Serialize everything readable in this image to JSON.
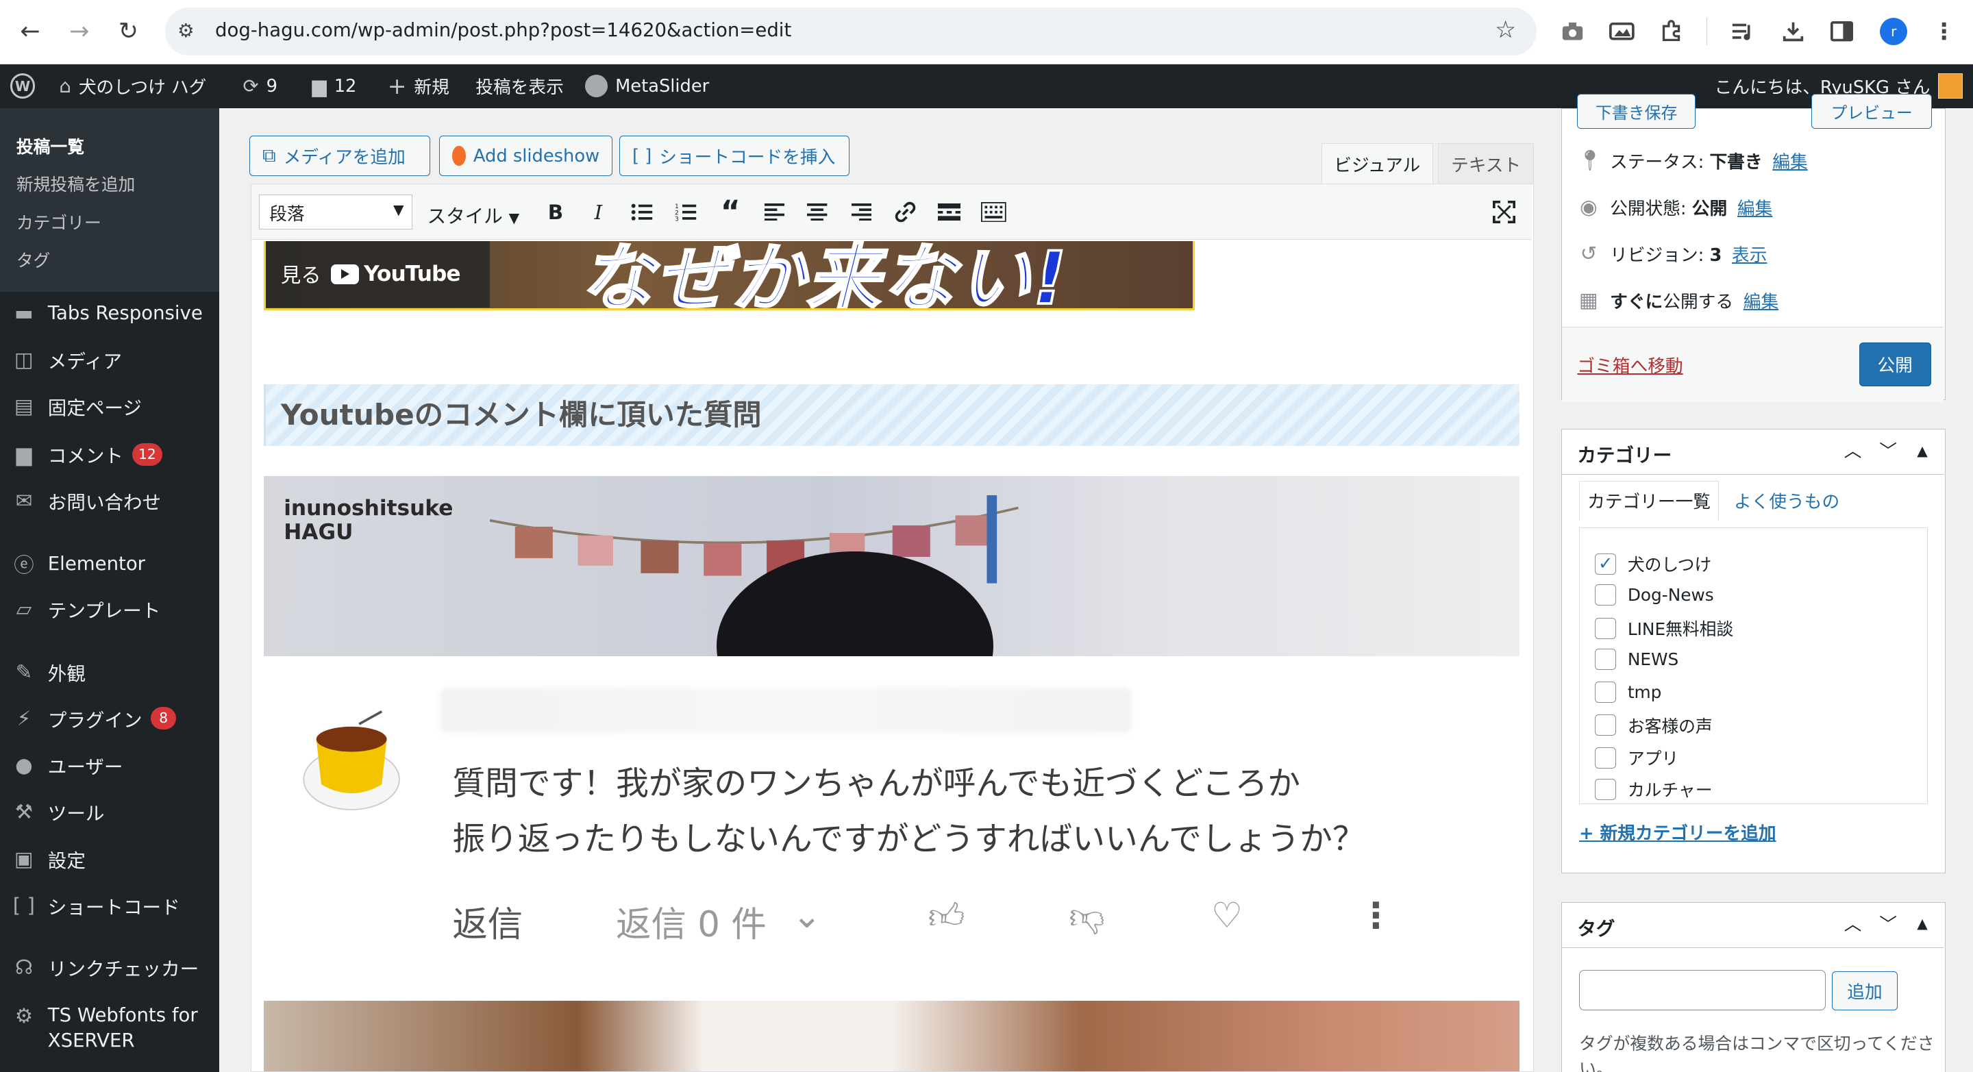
{
  "browser": {
    "url": "dog-hagu.com/wp-admin/post.php?post=14620&action=edit",
    "profile_initial": "r"
  },
  "adminbar": {
    "site_name": "犬のしつけ ハグ",
    "updates_count": "9",
    "comments_count": "12",
    "new_label": "新規",
    "view_post": "投稿を表示",
    "metaslider": "MetaSlider",
    "greeting": "こんにちは、RyuSKG さん"
  },
  "sidebar": {
    "submenu": [
      "投稿一覧",
      "新規投稿を追加",
      "カテゴリー",
      "タグ"
    ],
    "items": [
      {
        "label": "Tabs Responsive",
        "icon": "folder-icon"
      },
      {
        "label": "メディア",
        "icon": "media-icon"
      },
      {
        "label": "固定ページ",
        "icon": "page-icon"
      },
      {
        "label": "コメント",
        "icon": "comment-icon",
        "badge": "12"
      },
      {
        "label": "お問い合わせ",
        "icon": "mail-icon"
      },
      {
        "label": "Elementor",
        "icon": "elementor-icon"
      },
      {
        "label": "テンプレート",
        "icon": "folder-open-icon"
      },
      {
        "label": "外観",
        "icon": "brush-icon"
      },
      {
        "label": "プラグイン",
        "icon": "plugin-icon",
        "badge": "8"
      },
      {
        "label": "ユーザー",
        "icon": "user-icon"
      },
      {
        "label": "ツール",
        "icon": "wrench-icon"
      },
      {
        "label": "設定",
        "icon": "settings-icon"
      },
      {
        "label": "ショートコード",
        "icon": "shortcode-icon"
      },
      {
        "label": "リンクチェッカー",
        "icon": "link-checker-icon"
      },
      {
        "label": "TS Webfonts for XSERVER",
        "icon": "gear-icon"
      }
    ]
  },
  "editor": {
    "add_media": "メディアを追加",
    "add_slideshow": "Add slideshow",
    "insert_shortcode": "ショートコードを挿入",
    "tab_visual": "ビジュアル",
    "tab_text": "テキスト",
    "format_select": "段落",
    "style_select": "スタイル",
    "yt_watch": "見る",
    "yt_logo": "YouTube",
    "yt_title_overlay": "なぜか来ない!",
    "heading": "Youtubeのコメント欄に頂いた質問",
    "photo_logo_line1": "inunoshitsuke",
    "photo_logo_line2": "HAGU",
    "comment_line1": "質問です！我が家のワンちゃんが呼んでも近づくどころか",
    "comment_line2": "振り返ったりもしないんですがどうすればいいんでしょうか？",
    "reply": "返信",
    "replies": "返信 0 件"
  },
  "publish": {
    "save_draft": "下書き保存",
    "preview": "プレビュー",
    "status_label": "ステータス: ",
    "status_value": "下書き",
    "visibility_label": "公開状態: ",
    "visibility_value": "公開",
    "revisions_label": "リビジョン: ",
    "revisions_value": "3",
    "revisions_link": "表示",
    "schedule_label": "すぐに",
    "schedule_value": "公開する",
    "edit_link": "編集",
    "trash": "ゴミ箱へ移動",
    "publish": "公開"
  },
  "categories": {
    "title": "カテゴリー",
    "tab_all": "カテゴリー一覧",
    "tab_popular": "よく使うもの",
    "items": [
      {
        "label": "犬のしつけ",
        "checked": true
      },
      {
        "label": "Dog-News",
        "checked": false
      },
      {
        "label": "LINE無料相談",
        "checked": false
      },
      {
        "label": "NEWS",
        "checked": false
      },
      {
        "label": "tmp",
        "checked": false
      },
      {
        "label": "お客様の声",
        "checked": false
      },
      {
        "label": "アプリ",
        "checked": false
      },
      {
        "label": "カルチャー",
        "checked": false
      }
    ],
    "add_new": "+ 新規カテゴリーを追加"
  },
  "tags": {
    "title": "タグ",
    "add": "追加",
    "help": "タグが複数ある場合はコンマで区切ってください。"
  },
  "colors": {
    "wp_dark": "#1d2327",
    "wp_blue": "#2271b1",
    "badge_red": "#d63638"
  }
}
